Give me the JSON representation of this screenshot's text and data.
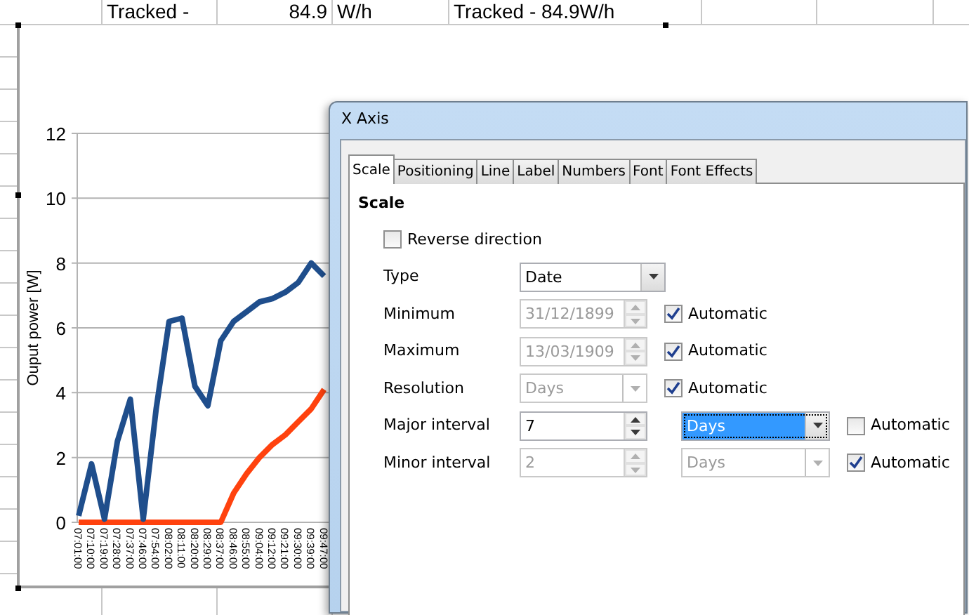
{
  "sheet": {
    "top_row": [
      {
        "text": "Tracked -",
        "kind": "text"
      },
      {
        "text": "84.9",
        "kind": "number"
      },
      {
        "text": "W/h",
        "kind": "text"
      },
      {
        "text": "Tracked - 84.9W/h",
        "kind": "text"
      }
    ]
  },
  "chart": {
    "chart_data": {
      "type": "line",
      "ylabel": "Ouput power [W]",
      "categories": [
        "07:01:00",
        "07:10:00",
        "07:19:00",
        "07:28:00",
        "07:37:00",
        "07:46:00",
        "07:54:00",
        "08:02:00",
        "08:11:00",
        "08:20:00",
        "08:29:00",
        "08:37:00",
        "08:46:00",
        "08:55:00",
        "09:04:00",
        "09:12:00",
        "09:21:00",
        "09:30:00",
        "09:39:00",
        "09:47:00"
      ],
      "ylim": [
        0,
        12
      ],
      "yticks": [
        0,
        2,
        4,
        6,
        8,
        10,
        12
      ],
      "grid": true,
      "series": [
        {
          "color": "#1f4e8c",
          "values": [
            0.2,
            1.8,
            0.1,
            2.5,
            3.8,
            0.1,
            3.5,
            6.2,
            6.3,
            4.2,
            3.6,
            5.6,
            6.2,
            6.5,
            6.8,
            6.9,
            7.1,
            7.4,
            8.0,
            7.6
          ]
        },
        {
          "color": "#ff420e",
          "values": [
            0,
            0,
            0,
            0,
            0,
            0,
            0,
            0,
            0,
            0,
            0,
            0,
            0.9,
            1.5,
            2.0,
            2.4,
            2.7,
            3.1,
            3.5,
            4.1
          ]
        }
      ]
    }
  },
  "dialog": {
    "title": "X Axis",
    "tabs": [
      {
        "label": "Scale",
        "selected": true
      },
      {
        "label": "Positioning",
        "selected": false
      },
      {
        "label": "Line",
        "selected": false
      },
      {
        "label": "Label",
        "selected": false
      },
      {
        "label": "Numbers",
        "selected": false
      },
      {
        "label": "Font",
        "selected": false
      },
      {
        "label": "Font Effects",
        "selected": false
      }
    ],
    "section": "Scale",
    "reverse": {
      "label": "Reverse direction",
      "checked": false
    },
    "rows": [
      {
        "label": "Type",
        "field": {
          "kind": "dropdown",
          "value": "Date",
          "disabled": false
        }
      },
      {
        "label": "Minimum",
        "field": {
          "kind": "spin",
          "value": "31/12/1899",
          "disabled": true
        },
        "automatic": {
          "label": "Automatic",
          "checked": true
        }
      },
      {
        "label": "Maximum",
        "field": {
          "kind": "spin",
          "value": "13/03/1909",
          "disabled": true
        },
        "automatic": {
          "label": "Automatic",
          "checked": true
        }
      },
      {
        "label": "Resolution",
        "field": {
          "kind": "dropdown",
          "value": "Days",
          "disabled": true
        },
        "automatic": {
          "label": "Automatic",
          "checked": true
        }
      },
      {
        "label": "Major interval",
        "field": {
          "kind": "spin",
          "value": "7",
          "disabled": false
        },
        "unit": {
          "value": "Days",
          "disabled": false,
          "selected": true
        },
        "automatic": {
          "label": "Automatic",
          "checked": false
        }
      },
      {
        "label": "Minor interval",
        "field": {
          "kind": "spin",
          "value": "2",
          "disabled": true
        },
        "unit": {
          "value": "Days",
          "disabled": true,
          "selected": false
        },
        "automatic": {
          "label": "Automatic",
          "checked": true
        }
      }
    ]
  }
}
